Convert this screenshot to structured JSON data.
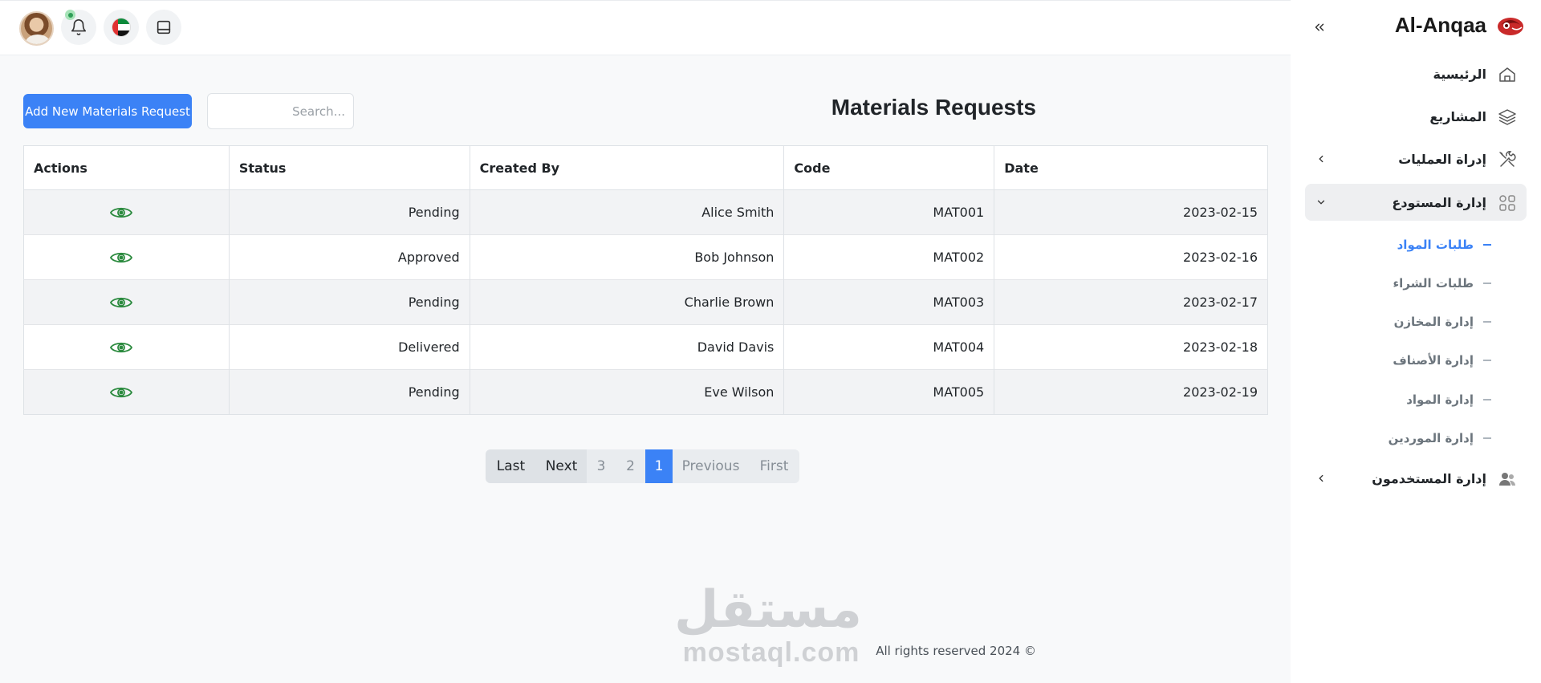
{
  "brand": {
    "name": "Al-Anqaa"
  },
  "header": {
    "icons": [
      "user-avatar",
      "notification-bell-icon",
      "uae-flag-icon",
      "tablet-icon"
    ]
  },
  "sidebar": {
    "items": [
      {
        "label": "الرئيسية",
        "icon": "home-icon"
      },
      {
        "label": "المشاريع",
        "icon": "layers-icon"
      },
      {
        "label": "إدراة العمليات",
        "icon": "tools-icon"
      },
      {
        "label": "إدارة المستودع",
        "icon": "grid-icon"
      },
      {
        "label": "إدارة المستخدمون",
        "icon": "users-icon"
      }
    ],
    "subitems": [
      {
        "label": "طلبات المواد",
        "active": true
      },
      {
        "label": "طلبات الشراء"
      },
      {
        "label": "إدارة المخازن"
      },
      {
        "label": "إدارة الأصناف"
      },
      {
        "label": "إدارة المواد"
      },
      {
        "label": "إدارة الموردين"
      }
    ]
  },
  "page": {
    "title": "Materials Requests",
    "add_button": "Add New Materials Request",
    "search_placeholder": "Search..."
  },
  "table": {
    "headers": [
      "Actions",
      "Status",
      "Created By",
      "Code",
      "Date"
    ],
    "rows": [
      {
        "status": "Pending",
        "created_by": "Alice Smith",
        "code": "MAT001",
        "date": "2023-02-15"
      },
      {
        "status": "Approved",
        "created_by": "Bob Johnson",
        "code": "MAT002",
        "date": "2023-02-16"
      },
      {
        "status": "Pending",
        "created_by": "Charlie Brown",
        "code": "MAT003",
        "date": "2023-02-17"
      },
      {
        "status": "Delivered",
        "created_by": "David Davis",
        "code": "MAT004",
        "date": "2023-02-18"
      },
      {
        "status": "Pending",
        "created_by": "Eve Wilson",
        "code": "MAT005",
        "date": "2023-02-19"
      }
    ]
  },
  "pagination": {
    "last": "Last",
    "next": "Next",
    "p3": "3",
    "p2": "2",
    "p1": "1",
    "previous": "Previous",
    "first": "First",
    "current_page": 1
  },
  "footer": {
    "text": "All rights reserved 2024 ©"
  },
  "watermark": {
    "arabic": "مستقل",
    "latin": "mostaql.com"
  },
  "colors": {
    "accent": "#3b82f6",
    "eye": "#2b8a3e",
    "logo": "#c92a2a"
  }
}
